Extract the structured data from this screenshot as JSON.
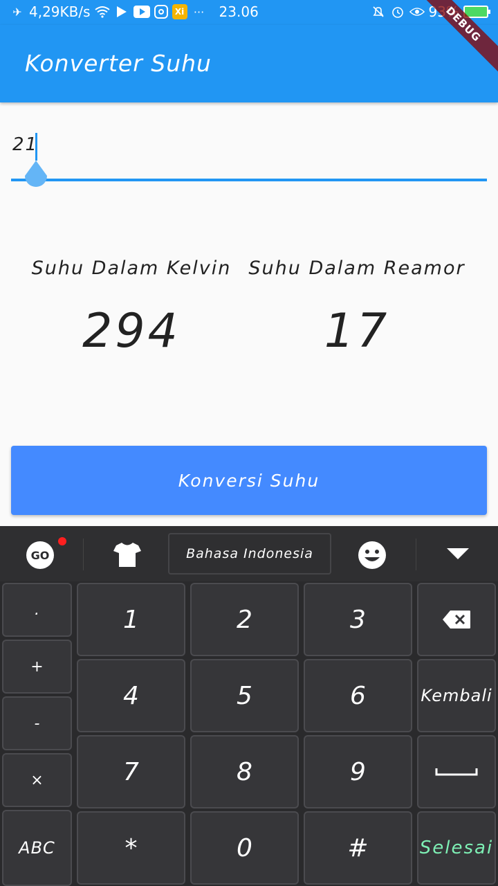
{
  "status_bar": {
    "speed": "4,29KB/s",
    "time": "23.06",
    "battery": "93%",
    "xi_label": "Xi",
    "icons": [
      "airplane-icon",
      "wifi-icon",
      "play-store-icon",
      "youtube-icon",
      "instagram-icon",
      "xiaomi-icon",
      "more-dots-icon",
      "mute-icon",
      "alarm-icon",
      "eye-icon",
      "battery-icon"
    ]
  },
  "debug_banner": "DEBUG",
  "app_bar": {
    "title": "Konverter Suhu"
  },
  "input": {
    "value": "21"
  },
  "results": {
    "kelvin_label": "Suhu Dalam Kelvin",
    "kelvin_value": "294",
    "reamur_label": "Suhu Dalam Reamor",
    "reamur_value": "17"
  },
  "convert_button": {
    "label": "Konversi Suhu"
  },
  "colors": {
    "primary": "#2196f3",
    "button": "#448aff",
    "keyboard_bg": "#2a2a2c",
    "done": "#7ef0b5"
  },
  "keyboard": {
    "go_label": "GO",
    "language": "Bahasa Indonesia",
    "keys": {
      "dot": ".",
      "plus": "+",
      "minus": "-",
      "times": "×",
      "abc": "ABC",
      "k1": "1",
      "k2": "2",
      "k3": "3",
      "k4": "4",
      "k5": "5",
      "k6": "6",
      "k7": "7",
      "k8": "8",
      "k9": "9",
      "star": "*",
      "k0": "0",
      "hash": "#",
      "back": "Kembali",
      "done": "Selesai"
    }
  }
}
